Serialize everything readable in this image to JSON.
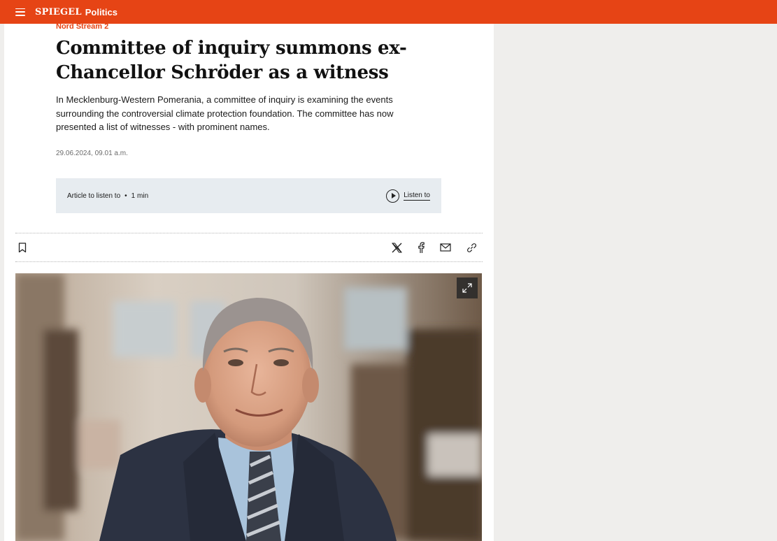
{
  "header": {
    "brand": "SPIEGEL",
    "section": "Politics"
  },
  "article": {
    "kicker": "Nord Stream 2",
    "headline": "Committee of inquiry summons ex-Chancellor Schröder as a witness",
    "teaser": "In Mecklenburg-Western Pomerania, a committee of inquiry is examining the events surrounding the controversial climate protection foundation. The committee has now presented a list of witnesses - with prominent names.",
    "date": "29.06.2024, 09.01 a.m."
  },
  "audio": {
    "label": "Article to listen to",
    "separator": "•",
    "duration": "1 min",
    "button_label": "Listen to"
  },
  "share": {
    "icons": [
      "bookmark-icon",
      "x-icon",
      "facebook-icon",
      "mail-icon",
      "link-icon"
    ]
  },
  "colors": {
    "brand": "#e64415",
    "audio_box": "#e7ecf0",
    "page_background": "#efeeec"
  }
}
